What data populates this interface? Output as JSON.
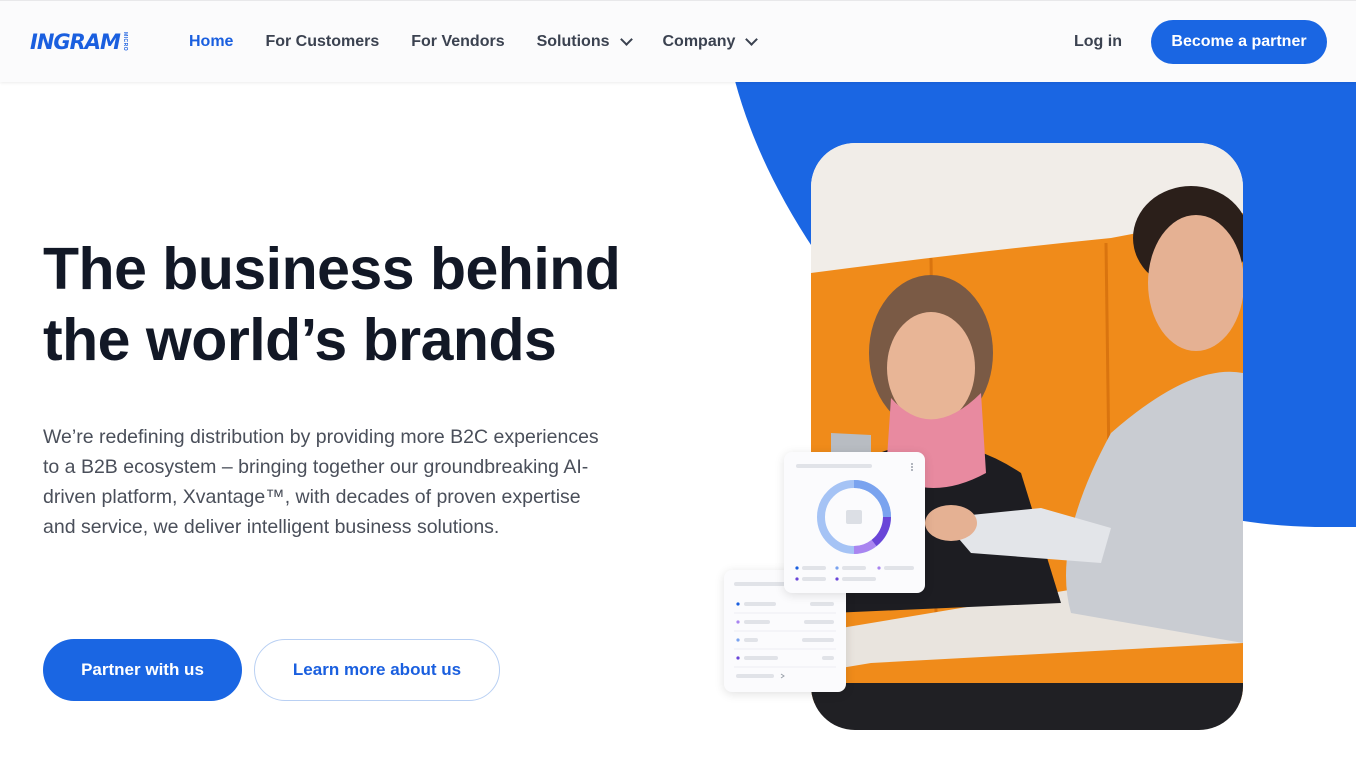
{
  "header": {
    "logo_text": "INGRAM",
    "logo_sub": "MICRO",
    "nav": [
      {
        "label": "Home",
        "active": true,
        "dropdown": false
      },
      {
        "label": "For Customers",
        "active": false,
        "dropdown": false
      },
      {
        "label": "For Vendors",
        "active": false,
        "dropdown": false
      },
      {
        "label": "Solutions",
        "active": false,
        "dropdown": true
      },
      {
        "label": "Company",
        "active": false,
        "dropdown": true
      }
    ],
    "login_label": "Log in",
    "cta_label": "Become a partner"
  },
  "hero": {
    "title_line1": "The business behind",
    "title_line2": "the world’s brands",
    "description": "We’re redefining distribution by providing more B2C experiences to a B2B ecosystem – bringing together our groundbreaking AI-driven platform, Xvantage™, with decades of proven expertise and service, we deliver intelligent business solutions.",
    "primary_button": "Partner with us",
    "secondary_button": "Learn more about us"
  },
  "colors": {
    "brand_blue": "#1a66e3",
    "heading": "#121826",
    "body_text": "#4a4f5a"
  },
  "icons": {
    "dropdown": "chevron-down-icon",
    "card_menu": "more-vertical-icon",
    "card_expand": "chevron-right-icon"
  }
}
